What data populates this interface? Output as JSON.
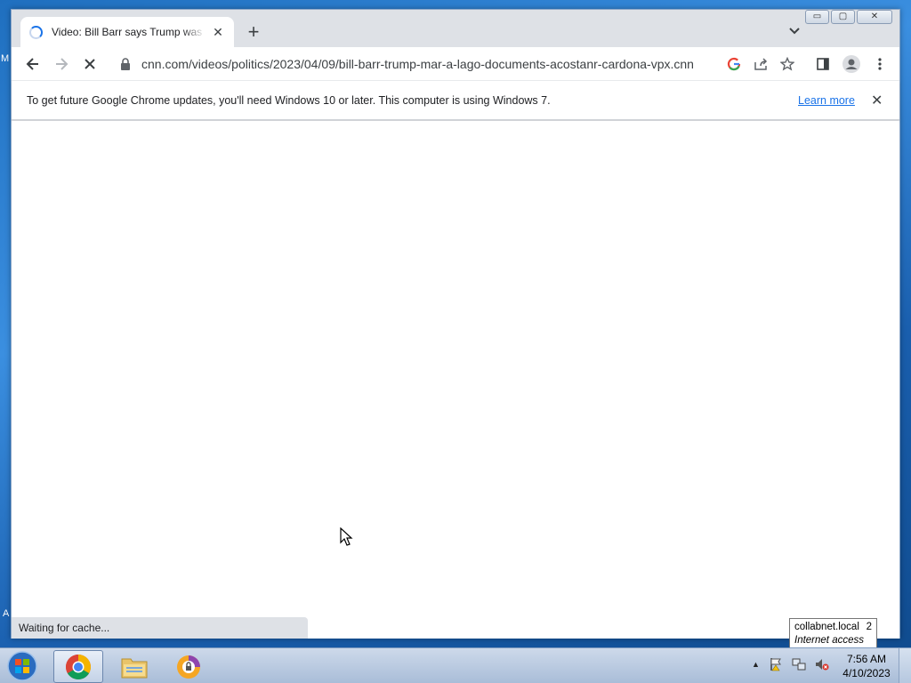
{
  "desktop": {
    "edge_text_top": "M",
    "edge_text_bottom": "A"
  },
  "browser": {
    "tab": {
      "title": "Video: Bill Barr says Trump was 'je",
      "loading": true
    },
    "new_tab_label": "+",
    "window_controls": {
      "minimize": "▭",
      "maximize": "▢",
      "close": "✕"
    },
    "address": {
      "url": "cnn.com/videos/politics/2023/04/09/bill-barr-trump-mar-a-lago-documents-acostanr-cardona-vpx.cnn"
    },
    "infobar": {
      "message": "To get future Google Chrome updates, you'll need Windows 10 or later. This computer is using Windows 7.",
      "link": "Learn more",
      "close": "✕"
    },
    "status": "Waiting for cache..."
  },
  "tooltip": {
    "network": "collabnet.local",
    "count": "2",
    "status": "Internet access"
  },
  "taskbar": {
    "clock": {
      "time": "7:56 AM",
      "date": "4/10/2023"
    },
    "tray_arrow": "▲"
  },
  "colors": {
    "accent": "#1a73e8",
    "chrome_frame": "#dee1e6",
    "desktop": "#1f6fbf"
  }
}
